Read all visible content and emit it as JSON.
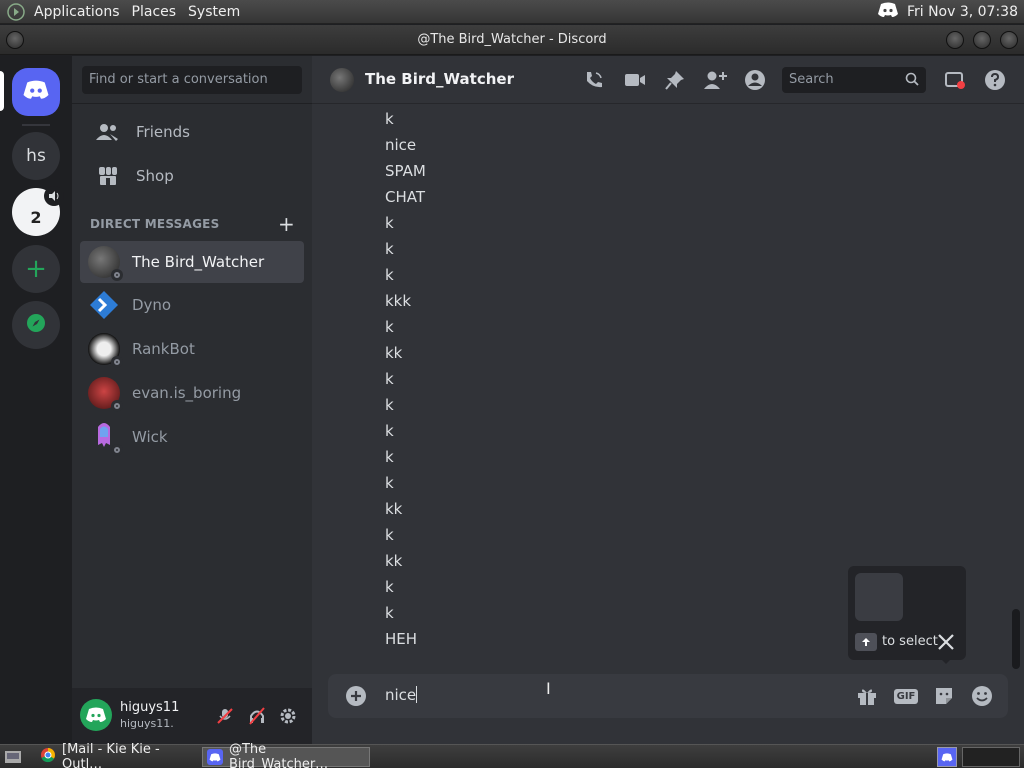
{
  "os": {
    "menus": [
      "Applications",
      "Places",
      "System"
    ],
    "clock": "Fri Nov  3, 07:38"
  },
  "window": {
    "title": "@The Bird_Watcher - Discord"
  },
  "servers": [
    {
      "label": "hs"
    },
    {
      "label": "2"
    }
  ],
  "sidebar": {
    "search_placeholder": "Find or start a conversation",
    "nav": [
      {
        "label": "Friends",
        "icon": "friends-icon"
      },
      {
        "label": "Shop",
        "icon": "shop-icon"
      }
    ],
    "dm_header": "DIRECT MESSAGES",
    "dms": [
      {
        "name": "The Bird_Watcher",
        "active": true
      },
      {
        "name": "Dyno"
      },
      {
        "name": "RankBot"
      },
      {
        "name": "evan.is_boring"
      },
      {
        "name": "Wick"
      }
    ]
  },
  "user": {
    "name": "higuys11",
    "tag": "higuys11."
  },
  "chat": {
    "title": "The Bird_Watcher",
    "search_placeholder": "Search",
    "messages": [
      "k",
      "nice",
      "SPAM",
      "CHAT",
      "k",
      "k",
      "k",
      "kkk",
      "k",
      "kk",
      "k",
      "k",
      "k",
      "k",
      "k",
      "kk",
      "k",
      "kk",
      "k",
      "k",
      "HEH"
    ],
    "input_value": "nice",
    "composer_icons": [
      "gift-icon",
      "gif-icon",
      "sticker-icon",
      "emoji-icon"
    ]
  },
  "popup": {
    "hint": "to select"
  },
  "taskbar": {
    "items": [
      {
        "label": "[Mail - Kie Kie - Outl…"
      },
      {
        "label": "@The Bird_Watcher…",
        "active": true
      }
    ]
  },
  "colors": {
    "blurple": "#5865f2",
    "green": "#23a55a",
    "rail": "#1e1f22",
    "sidebar": "#2b2d31",
    "chat": "#313338"
  }
}
